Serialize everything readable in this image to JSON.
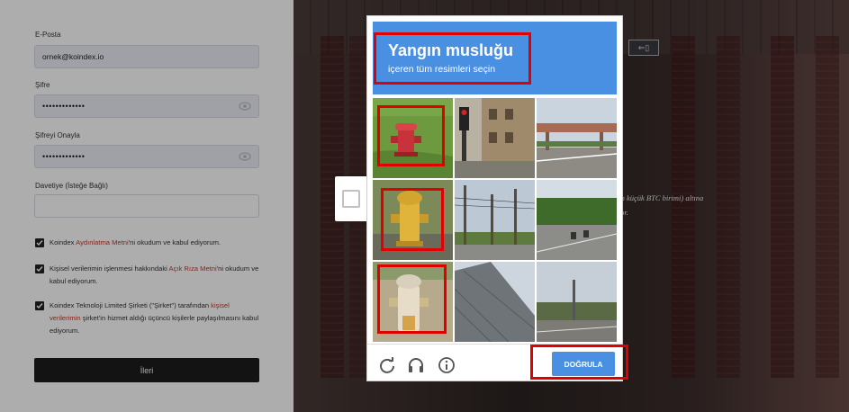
{
  "form": {
    "email_label": "E-Posta",
    "email_value": "ornek@koindex.io",
    "password_label": "Şifre",
    "password_value": "•••••••••••••",
    "password_confirm_label": "Şifreyi Onayla",
    "password_confirm_value": "•••••••••••••",
    "invite_label": "Davetiye (İsteğe Bağlı)",
    "invite_value": "",
    "checkbox1": {
      "pre": "Koindex ",
      "link": "Aydınlatma Metni",
      "post": "'ni okudum ve kabul ediyorum."
    },
    "checkbox2": {
      "pre": "Kişisel verilerimin işlenmesi hakkındaki ",
      "link": "Açık Rıza Metni",
      "post": "'ni okudum ve kabul ediyorum."
    },
    "checkbox3": {
      "pre": "Koindex Teknoloji Limited Şirketi (\"Şirket\") tarafından ",
      "link": "kişisel verilerimin",
      "post": " şirket'in hizmet aldığı üçüncü kişilerle paylaşılmasını kabul ediyorum."
    },
    "next_label": "İleri"
  },
  "background": {
    "italic_line1": "(en küçük BTC birimi) altına",
    "italic_line2": "ıyor."
  },
  "captcha": {
    "title": "Yangın musluğu",
    "subtitle": "içeren tüm resimleri seçin",
    "verify_label": "DOĞRULA",
    "tiles": [
      "hydrant-red",
      "traffic-light-street",
      "highway-overpass",
      "hydrant-yellow",
      "power-lines-road",
      "road-trees",
      "hydrant-white",
      "roof",
      "road-trees-2"
    ],
    "icons": [
      "reload-icon",
      "audio-icon",
      "info-icon"
    ]
  },
  "colors": {
    "captcha_blue": "#4a90e2",
    "highlight_red": "#e00000",
    "link_red": "#c0392b"
  }
}
